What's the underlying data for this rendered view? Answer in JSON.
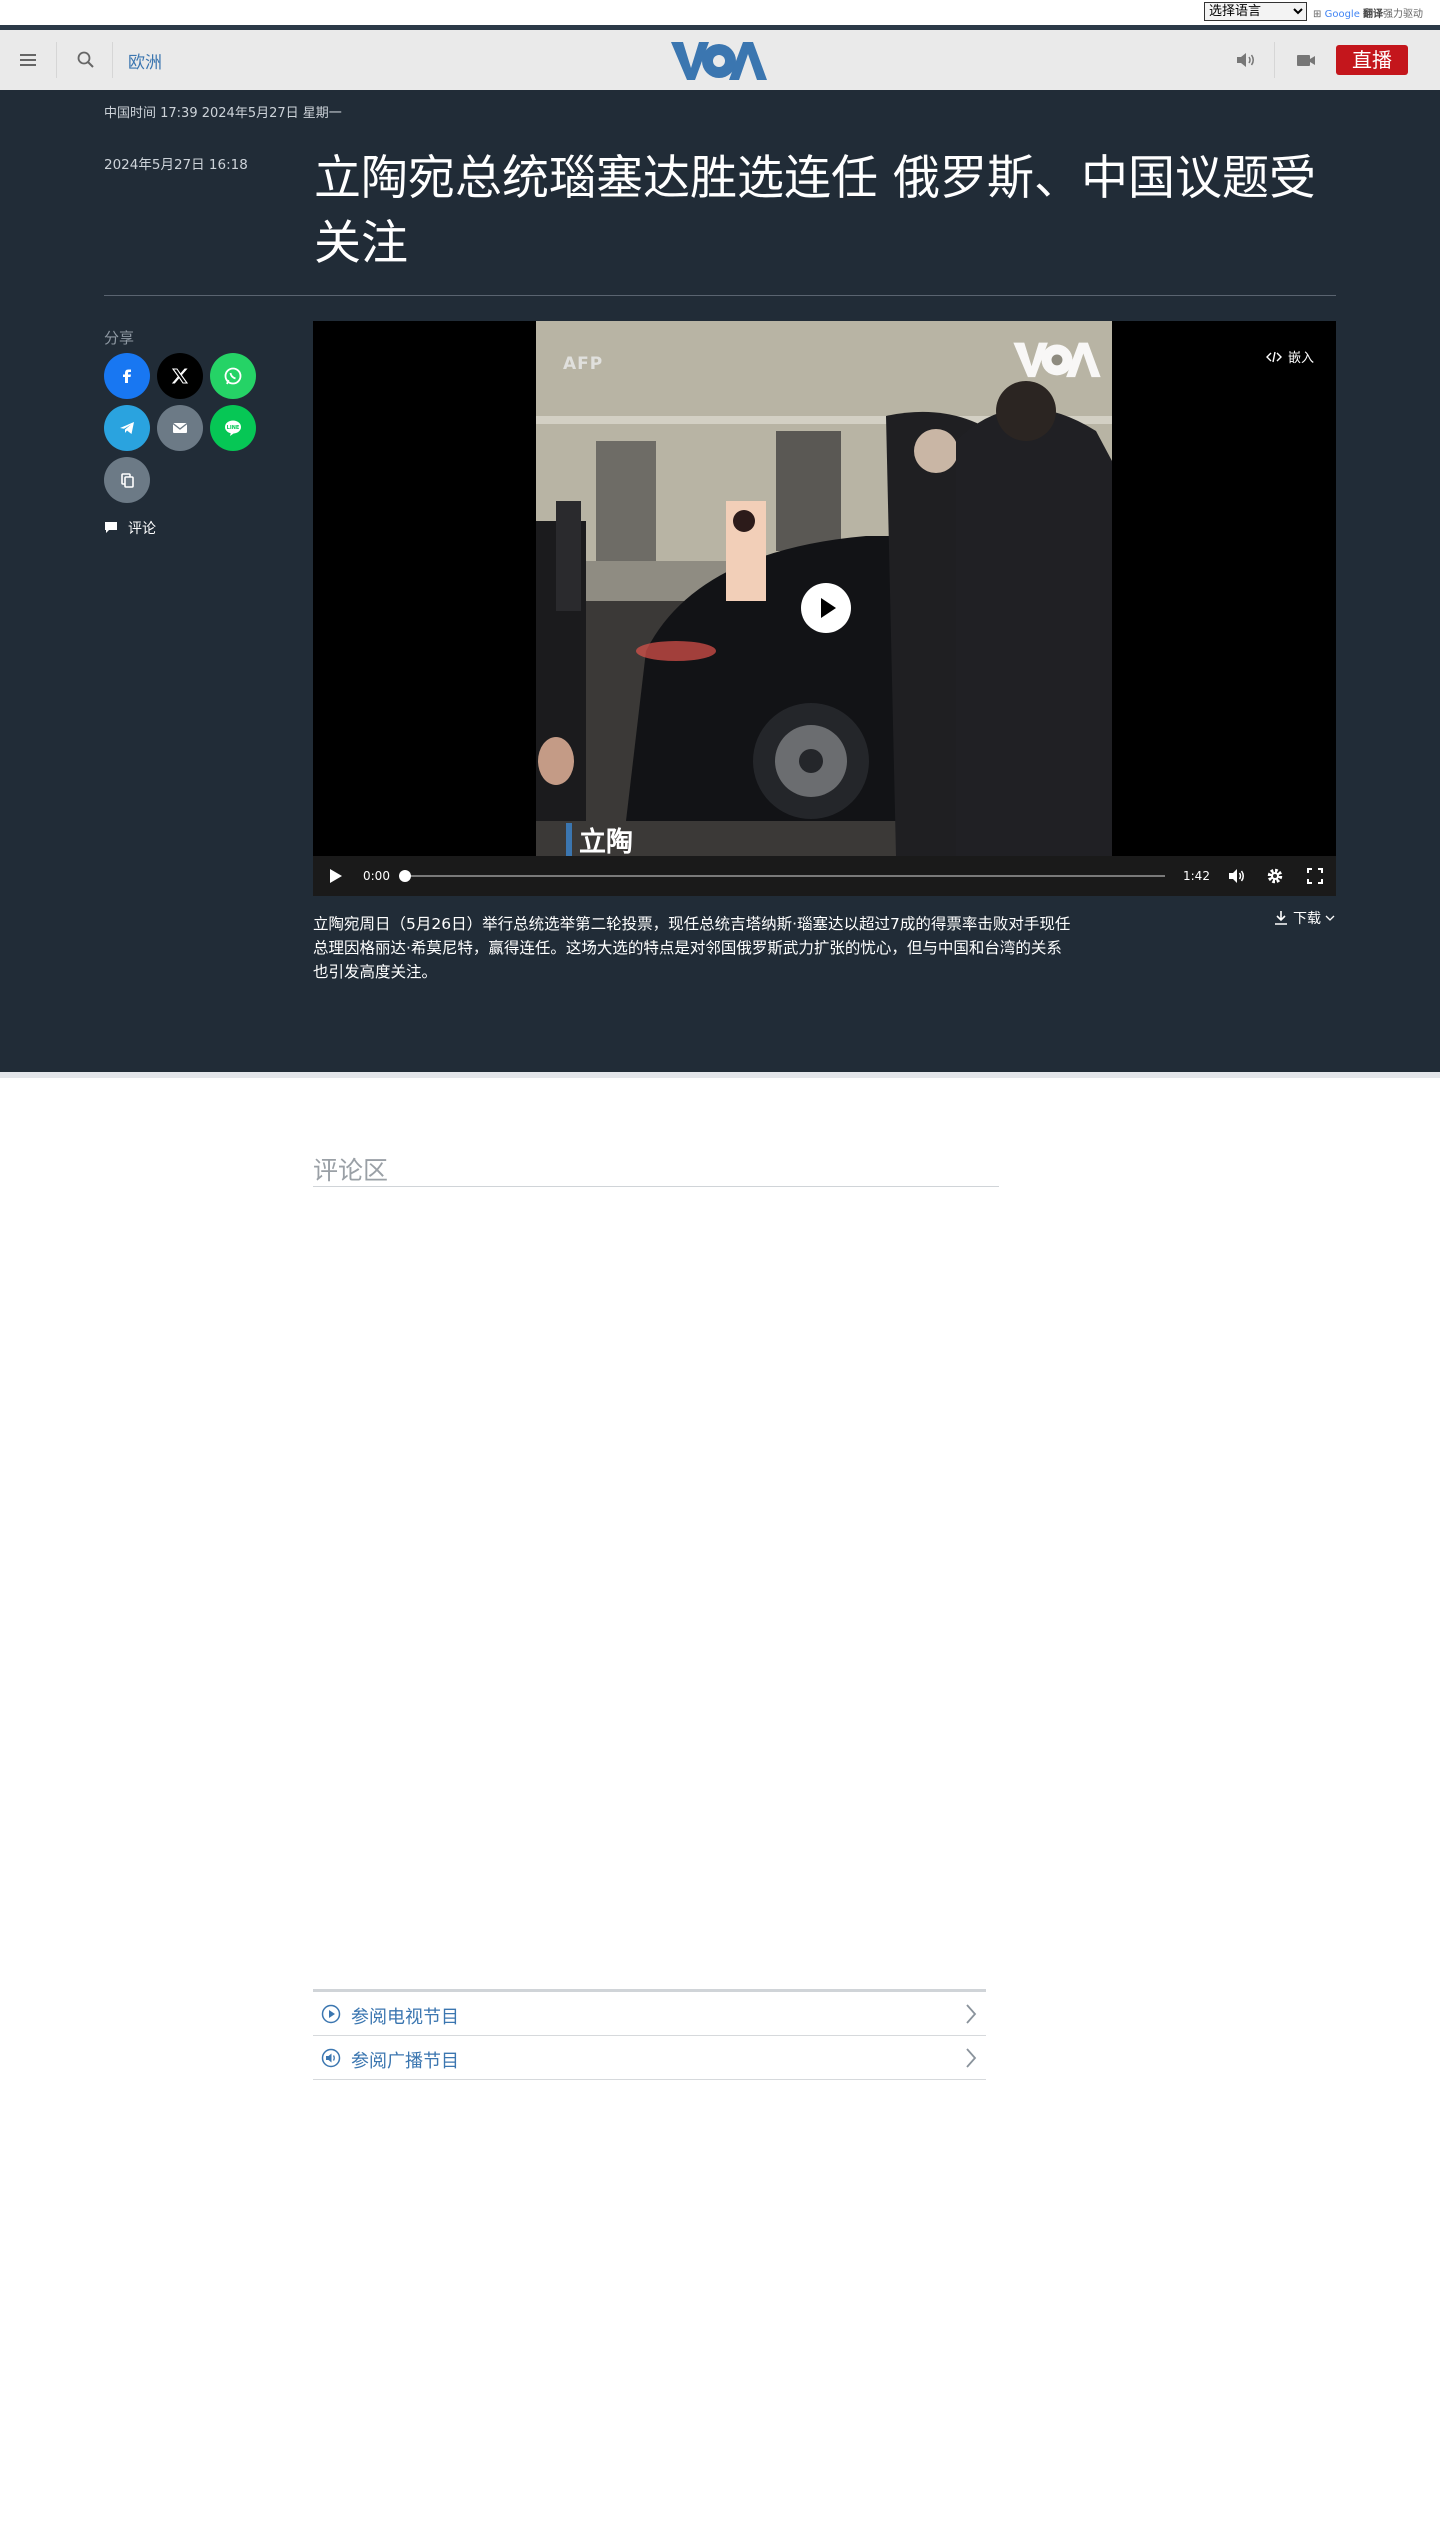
{
  "translate": {
    "select_label": "选择语言",
    "powered_google": "Google",
    "powered_translate": "翻译",
    "powered_suffix": "强力驱动"
  },
  "nav": {
    "section_label": "欧洲",
    "logo_text": "VOA",
    "live_label": "直播",
    "icons": [
      "menu-icon",
      "search-icon",
      "audio-icon",
      "video-icon"
    ]
  },
  "article": {
    "clock": "中国时间 17:39 2024年5月27日 星期一",
    "published": "2024年5月27日 16:18",
    "headline": "立陶宛总统瑙塞达胜选连任 俄罗斯、中国议题受关注",
    "share_label": "分享",
    "share_buttons": [
      "facebook",
      "x",
      "whatsapp",
      "telegram",
      "email",
      "line",
      "copy-link"
    ],
    "comments_label": "评论",
    "summary": "立陶宛周日（5月26日）举行总统选举第二轮投票，现任总统吉塔纳斯·瑙塞达以超过7成的得票率击败对手现任总理因格丽达·希莫尼特，赢得连任。这场大选的特点是对邻国俄罗斯武力扩张的忧心，但与中国和台湾的关系也引发高度关注。",
    "download_label": "下载"
  },
  "video": {
    "watermark_agency": "AFP",
    "watermark_logo": "VOA",
    "caption": "立陶",
    "embed_label": "嵌入",
    "current_time": "0:00",
    "duration": "1:42",
    "progress_fraction": 0.0
  },
  "comments_section": {
    "title": "评论区"
  },
  "program_links": [
    {
      "label": "参阅电视节目",
      "icon": "tv-play-icon"
    },
    {
      "label": "参阅广播节目",
      "icon": "radio-icon"
    }
  ],
  "colors": {
    "hero_bg": "#212c37",
    "brand_blue": "#3b76b0",
    "live_red": "#c4161c",
    "facebook": "#1877f2",
    "x": "#000000",
    "whatsapp": "#25d366",
    "telegram": "#2aa3df",
    "email": "#6c7a86",
    "line": "#06c755",
    "copy": "#6c7a86"
  }
}
